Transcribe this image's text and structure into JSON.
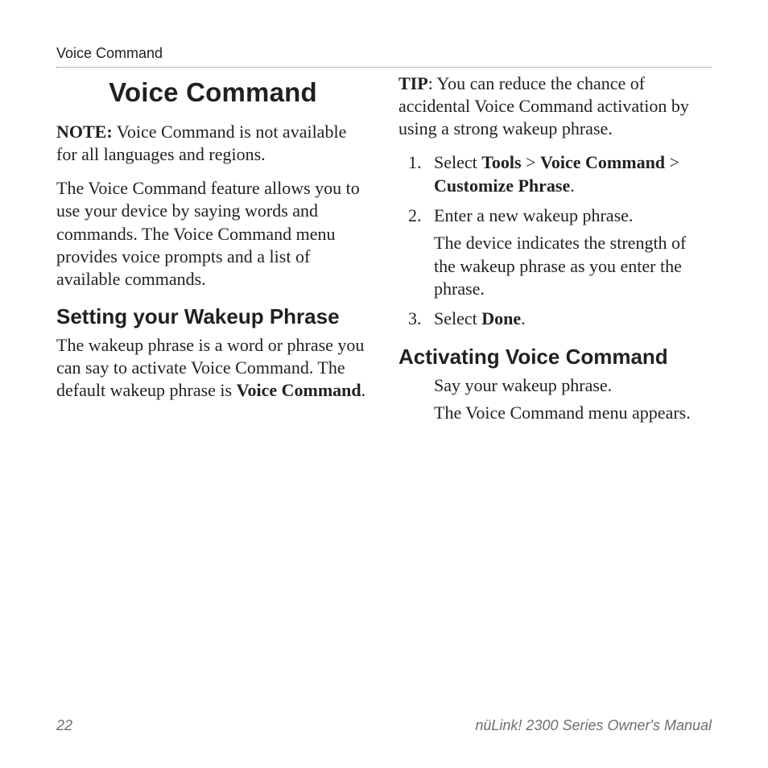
{
  "running_head": "Voice Command",
  "title": "Voice Command",
  "note_label": "NOTE:",
  "note_text": " Voice Command is not available for all languages and regions.",
  "intro": "The Voice Command feature allows you to use your device by saying words and commands. The Voice Command menu provides voice prompts and a list of available commands.",
  "section1_title": "Setting your Wakeup Phrase",
  "wakeup_intro_a": "The wakeup phrase is a word or phrase you can say to activate Voice Command. The default wakeup phrase is ",
  "wakeup_intro_bold": "Voice Command",
  "wakeup_intro_b": ".",
  "tip_label": "TIP",
  "tip_text": ": You can reduce the chance of accidental Voice Command activation by using a strong wakeup phrase.",
  "steps": {
    "s1_num": "1.",
    "s1_a": "Select ",
    "s1_b1": "Tools",
    "s1_sep1": " > ",
    "s1_b2": "Voice Command",
    "s1_sep2": " > ",
    "s1_b3": "Customize Phrase",
    "s1_end": ".",
    "s2_num": "2.",
    "s2_text": "Enter a new wakeup phrase.",
    "s2_sub": "The device indicates the strength of the wakeup phrase as you enter the phrase.",
    "s3_num": "3.",
    "s3_a": "Select ",
    "s3_b": "Done",
    "s3_end": "."
  },
  "section2_title": "Activating Voice Command",
  "activate_a": "Say your wakeup phrase.",
  "activate_b": "The Voice Command menu appears.",
  "footer_page": "22",
  "footer_text": "nüLink! 2300 Series Owner's Manual"
}
